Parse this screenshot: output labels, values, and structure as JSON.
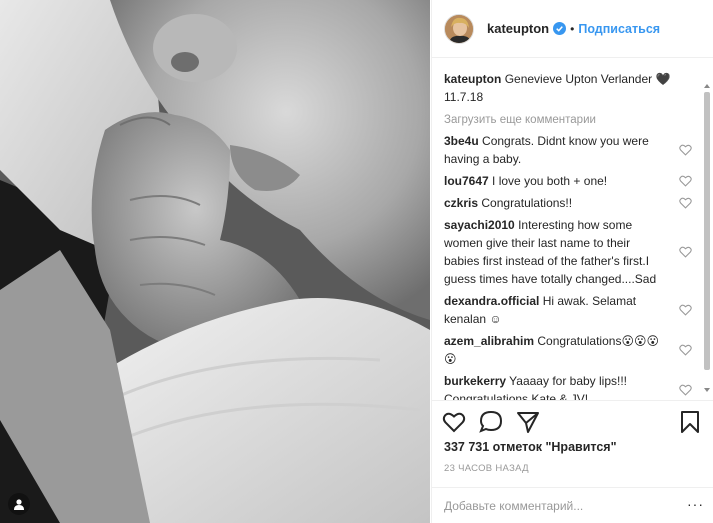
{
  "post": {
    "username": "kateupton",
    "follow_label": "Подписаться",
    "dot": "•",
    "caption_user": "kateupton",
    "caption_text": "Genevieve Upton Verlander 🖤 11.7.18",
    "load_more": "Загрузить еще комментарии",
    "comments": [
      {
        "user": "3be4u",
        "text": "Congrats. Didnt know you were having a baby."
      },
      {
        "user": "lou7647",
        "text": "I love you both + one!"
      },
      {
        "user": "czkris",
        "text": "Congratulations!!"
      },
      {
        "user": "sayachi2010",
        "text": "Interesting how some women give their last name to their babies first instead of the father's first.I guess times have totally changed....Sad"
      },
      {
        "user": "dexandra.official",
        "text": "Hi awak. Selamat kenalan ☺"
      },
      {
        "user": "azem_alibrahim",
        "text": "Congratulations😮😮😮😮"
      },
      {
        "user": "burkekerry",
        "text": "Yaaaay for baby lips!!! Congratulations Kate & JV!"
      }
    ],
    "likes_count": "337 731",
    "likes_label": "отметок \"Нравится\"",
    "time": "23 ЧАСОВ НАЗАД",
    "add_comment_placeholder": "Добавьте комментарий...",
    "more_dots": "···"
  },
  "icons": {
    "tag": "person-tag-icon",
    "verified": "verified-badge-icon",
    "like": "heart-icon",
    "comment": "speech-bubble-icon",
    "share": "share-icon",
    "save": "bookmark-icon"
  },
  "colors": {
    "link": "#3897f0",
    "muted": "#999999",
    "text": "#262626"
  }
}
